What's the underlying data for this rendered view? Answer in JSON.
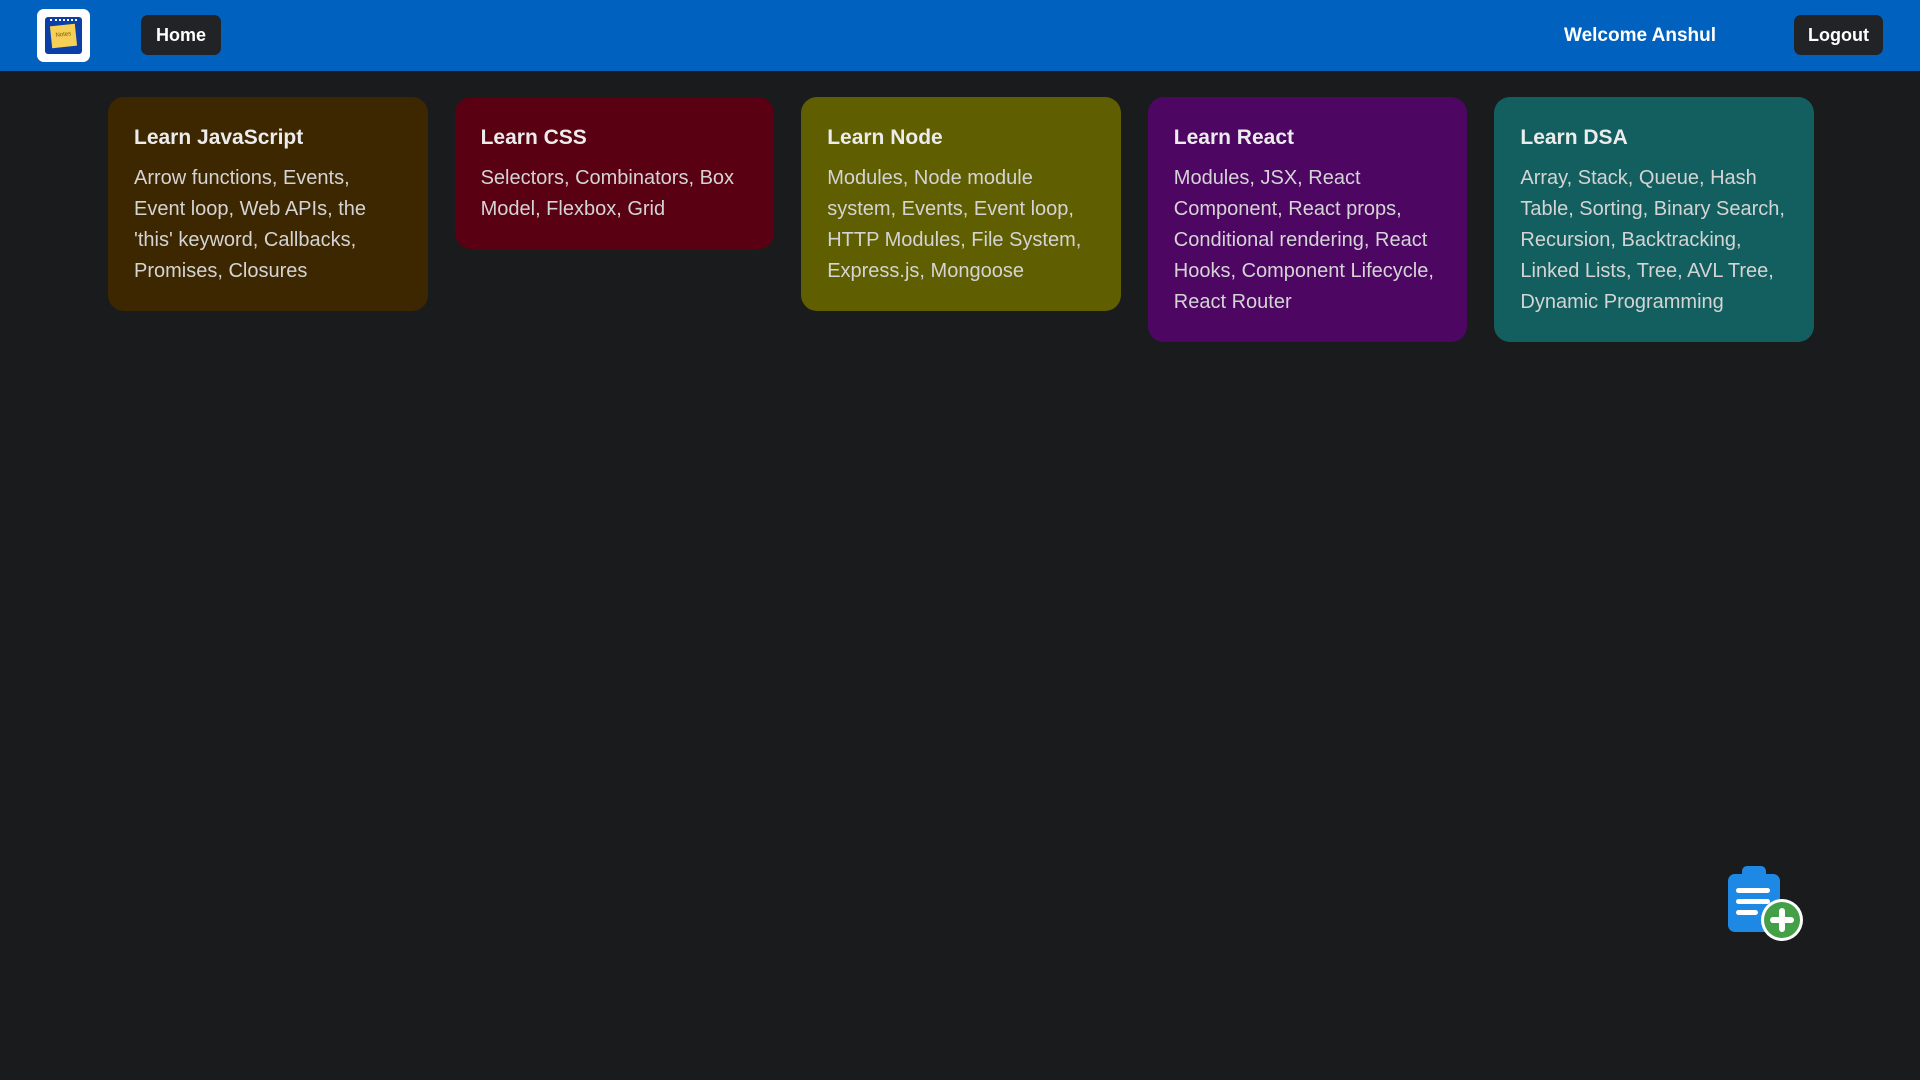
{
  "navbar": {
    "logo_text": "Notes",
    "home_label": "Home",
    "welcome_text": "Welcome Anshul",
    "logout_label": "Logout"
  },
  "notes": [
    {
      "title": "Learn JavaScript",
      "body": "Arrow functions, Events, Event loop, Web APIs, the 'this' keyword, Callbacks, Promises, Closures",
      "color": "#3d2700"
    },
    {
      "title": "Learn CSS",
      "body": "Selectors, Combinators, Box Model, Flexbox, Grid",
      "color": "#590013"
    },
    {
      "title": "Learn Node",
      "body": "Modules, Node module system, Events, Event loop, HTTP Modules, File System, Express.js, Mongoose",
      "color": "#5f5e00"
    },
    {
      "title": "Learn React",
      "body": "Modules, JSX, React Component, React props, Conditional rendering, React Hooks, Component Lifecycle, React Router",
      "color": "#4d0763"
    },
    {
      "title": "Learn DSA",
      "body": "Array, Stack, Queue, Hash Table, Sorting, Binary Search, Recursion, Backtracking, Linked Lists, Tree, AVL Tree, Dynamic Programming",
      "color": "#135f5f"
    }
  ],
  "fab": {
    "icon": "add-note-icon",
    "clipboard_color": "#1e88e5",
    "plus_color": "#43a047"
  },
  "colors": {
    "navbar": "#0061bf",
    "background": "#1a1b1d",
    "button": "#212326"
  }
}
